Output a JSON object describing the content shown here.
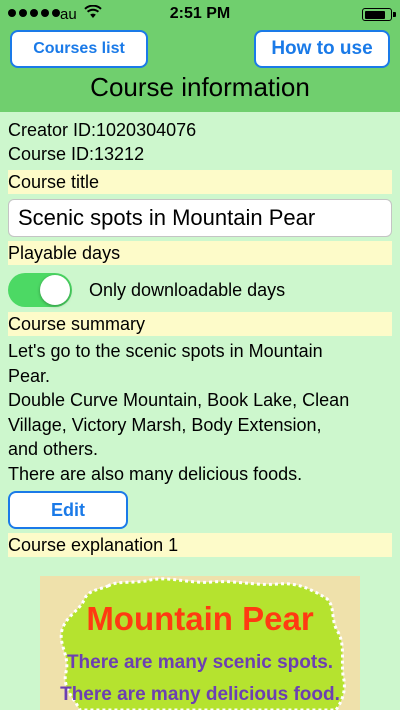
{
  "status_bar": {
    "carrier": "au",
    "time": "2:51 PM",
    "signal_bars": 5,
    "battery_level": 0.85,
    "icons": [
      "signal-dots-icon",
      "wifi-icon",
      "battery-icon"
    ]
  },
  "nav": {
    "courses_list_label": "Courses list",
    "how_to_use_label": "How to use",
    "title": "Course information"
  },
  "course": {
    "creator_id": "Creator ID:1020304076",
    "course_id": "Course ID:13212",
    "title_label": "Course title",
    "title_value": "Scenic spots in Mountain Pear",
    "playable_days_label": "Playable days",
    "playable_days_toggle_on": true,
    "playable_days_option": "Only downloadable days",
    "summary_label": "Course summary",
    "summary_lines": [
      "Let's go to the scenic spots in Mountain",
      "Pear.",
      "Double Curve Mountain, Book Lake, Clean",
      "Village, Victory Marsh, Body Extension,",
      "and others.",
      "There are also many delicious foods."
    ],
    "edit_label": "Edit",
    "explanation_label": "Course explanation 1"
  },
  "explanation_image": {
    "title": "Mountain Pear",
    "line1": "There are many scenic spots.",
    "line2": "There are many delicious food."
  },
  "colors": {
    "header_green": "#70cf6e",
    "background": "#cdf7cd",
    "label_yellow": "#fdfbc9",
    "accent_blue": "#1a7ae8",
    "toggle_green": "#4cd964",
    "map_title_red": "#ff3a12",
    "map_text_purple": "#6c3fb2"
  }
}
